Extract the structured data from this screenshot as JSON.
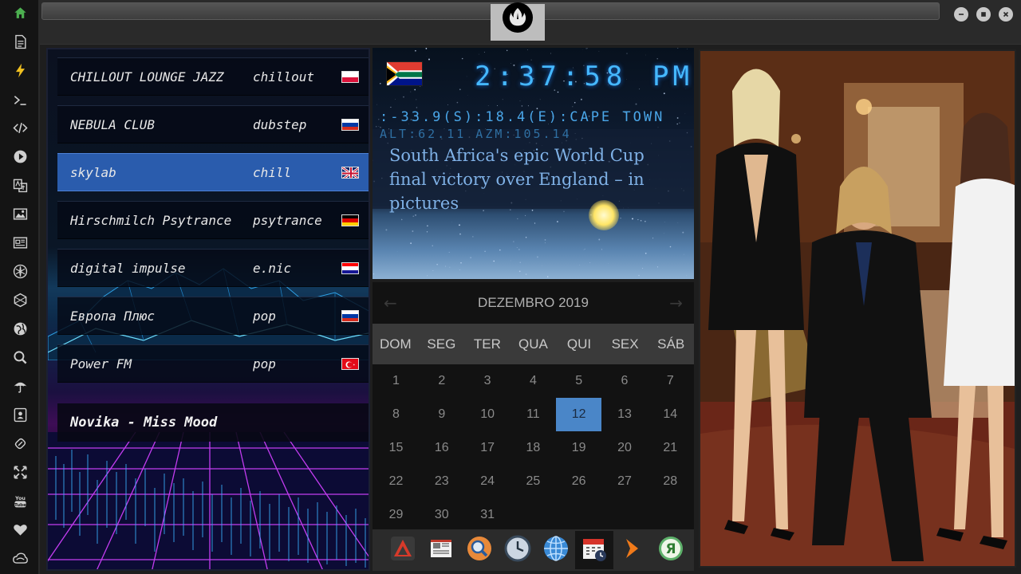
{
  "sidebar": {
    "items": [
      {
        "icon": "home-icon",
        "color": "#4caf50"
      },
      {
        "icon": "document-icon",
        "color": "#cfcfcf"
      },
      {
        "icon": "lightning-icon",
        "color": "#f0c020"
      },
      {
        "icon": "terminal-icon",
        "color": "#cfcfcf"
      },
      {
        "icon": "code-icon",
        "color": "#cfcfcf"
      },
      {
        "icon": "play-icon",
        "color": "#cfcfcf"
      },
      {
        "icon": "translate-icon",
        "color": "#cfcfcf"
      },
      {
        "icon": "image-icon",
        "color": "#cfcfcf"
      },
      {
        "icon": "news-icon",
        "color": "#cfcfcf"
      },
      {
        "icon": "rebel-icon",
        "color": "#cfcfcf"
      },
      {
        "icon": "hexagon-icon",
        "color": "#cfcfcf"
      },
      {
        "icon": "globe-icon",
        "color": "#cfcfcf"
      },
      {
        "icon": "search-icon",
        "color": "#cfcfcf"
      },
      {
        "icon": "umbrella-icon",
        "color": "#cfcfcf"
      },
      {
        "icon": "contacts-icon",
        "color": "#cfcfcf"
      },
      {
        "icon": "link-icon",
        "color": "#cfcfcf"
      },
      {
        "icon": "expand-icon",
        "color": "#cfcfcf"
      },
      {
        "icon": "youtube-icon",
        "color": "#cfcfcf"
      },
      {
        "icon": "heart-icon",
        "color": "#cfcfcf"
      },
      {
        "icon": "cloud-icon",
        "color": "#cfcfcf"
      }
    ]
  },
  "radio": {
    "stations": [
      {
        "name": "CHILLOUT LOUNGE JAZZ",
        "genre": "chillout",
        "flag": "poland",
        "active": false
      },
      {
        "name": "NEBULA CLUB",
        "genre": "dubstep",
        "flag": "russia",
        "active": false
      },
      {
        "name": "skylab",
        "genre": "chill",
        "flag": "uk",
        "active": true
      },
      {
        "name": "Hirschmilch Psytrance",
        "genre": "psytrance",
        "flag": "germany",
        "active": false
      },
      {
        "name": "digital impulse",
        "genre": "e.nic",
        "flag": "croatia",
        "active": false
      },
      {
        "name": "Европа Плюс",
        "genre": "pop",
        "flag": "russia",
        "active": false
      },
      {
        "name": "Power FM",
        "genre": "pop",
        "flag": "turkey",
        "active": false
      }
    ],
    "now_playing": "Novika - Miss Mood"
  },
  "clock": {
    "flag": "south-africa",
    "time": "2:37:58",
    "ampm": "PM",
    "coords": ":-33.9(S):18.4(E):CAPE TOWN",
    "alt": "ALT:62.11 AZM:105.14",
    "headline": "South Africa's epic World Cup final victory over England – in pictures"
  },
  "calendar": {
    "month": "DEZEMBRO 2019",
    "prev": "←",
    "next": "→",
    "weekdays": [
      "DOM",
      "SEG",
      "TER",
      "QUA",
      "QUI",
      "SEX",
      "SÁB"
    ],
    "days": [
      "1",
      "2",
      "3",
      "4",
      "5",
      "6",
      "7",
      "8",
      "9",
      "10",
      "11",
      "12",
      "13",
      "14",
      "15",
      "16",
      "17",
      "18",
      "19",
      "20",
      "21",
      "22",
      "23",
      "24",
      "25",
      "26",
      "27",
      "28",
      "29",
      "30",
      "31"
    ],
    "today": "12"
  },
  "dock": {
    "items": [
      {
        "icon": "launcher-icon"
      },
      {
        "icon": "news-reader-icon"
      },
      {
        "icon": "search-app-icon"
      },
      {
        "icon": "clock-app-icon"
      },
      {
        "icon": "browser-icon"
      },
      {
        "icon": "calendar-app-icon",
        "selected": true
      },
      {
        "icon": "arrow-app-icon"
      },
      {
        "icon": "yandex-icon",
        "letter": "Я"
      }
    ]
  }
}
